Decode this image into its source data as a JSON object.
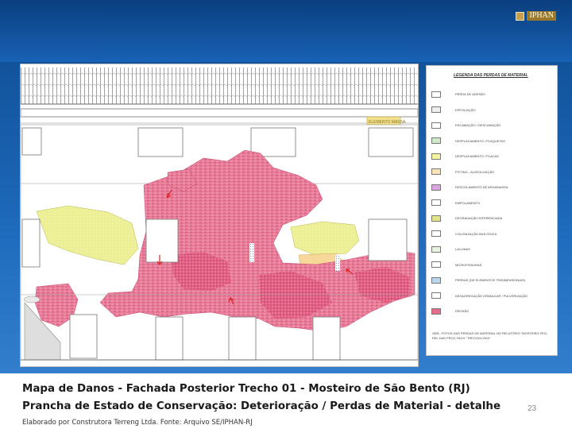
{
  "logo": {
    "text": "IPHAN"
  },
  "drawing": {
    "stamp": "ELEMENTO MASSA"
  },
  "legend": {
    "title": "LEGENDA DAS PERDAS DE MATERIAL",
    "items": [
      {
        "label": "PERDA DE ADESÃO",
        "color": "#ffffff"
      },
      {
        "label": "ESFOLIAÇÃO",
        "color": "#eeeeee"
      },
      {
        "label": "ESCAMAÇÃO / DESCAMAÇÃO",
        "color": "#ffffff"
      },
      {
        "label": "DESPLACAMENTO / PLAQUETAS",
        "color": "#cfe8c8"
      },
      {
        "label": "DESPLACAMENTO / PLACAS",
        "color": "#f3f3a0"
      },
      {
        "label": "PITTING - ALVEOLIZAÇÃO",
        "color": "#f9e3b8"
      },
      {
        "label": "DESCOLAMENTO DE ARGAMASSA",
        "color": "#d9a6df"
      },
      {
        "label": "EMPOLAMENTO",
        "color": "#ffffff"
      },
      {
        "label": "DEGRADAÇÃO DIFERENCIADA",
        "color": "#e3e38a"
      },
      {
        "label": "COLONIZAÇÃO BIOLÓGICA",
        "color": "#ffffff"
      },
      {
        "label": "LACUNAS",
        "color": "#e6f4e0"
      },
      {
        "label": "MICROFISSURAS",
        "color": "#ffffff"
      },
      {
        "label": "PERDAS (DE ELEMENTOS TRIDIMENSIONAIS)",
        "color": "#b9d6ee"
      },
      {
        "label": "DESAGREGAÇÃO GRANULAR / PULVERIZAÇÃO",
        "color": "#ffffff"
      },
      {
        "label": "EROSÃO",
        "color": "#e86b8c"
      }
    ],
    "note": "OBS.: FOTOS DAS PERDAS DE MATERIAL NO RELATÓRIO \"MOSTEIRO FEG-REL DAS PROC FACH \"TRECHO1-R04\""
  },
  "caption": {
    "line1": "Mapa de Danos - Fachada Posterior Trecho 01 - Mosteiro de São Bento (RJ)",
    "line2": "Prancha de Estado de Conservação: Deterioração / Perdas de Material - detalhe",
    "credit": "Elaborado por Construtora Terreng Ltda. Fonte: Arquivo SE/IPHAN-RJ"
  },
  "page_number": "23"
}
